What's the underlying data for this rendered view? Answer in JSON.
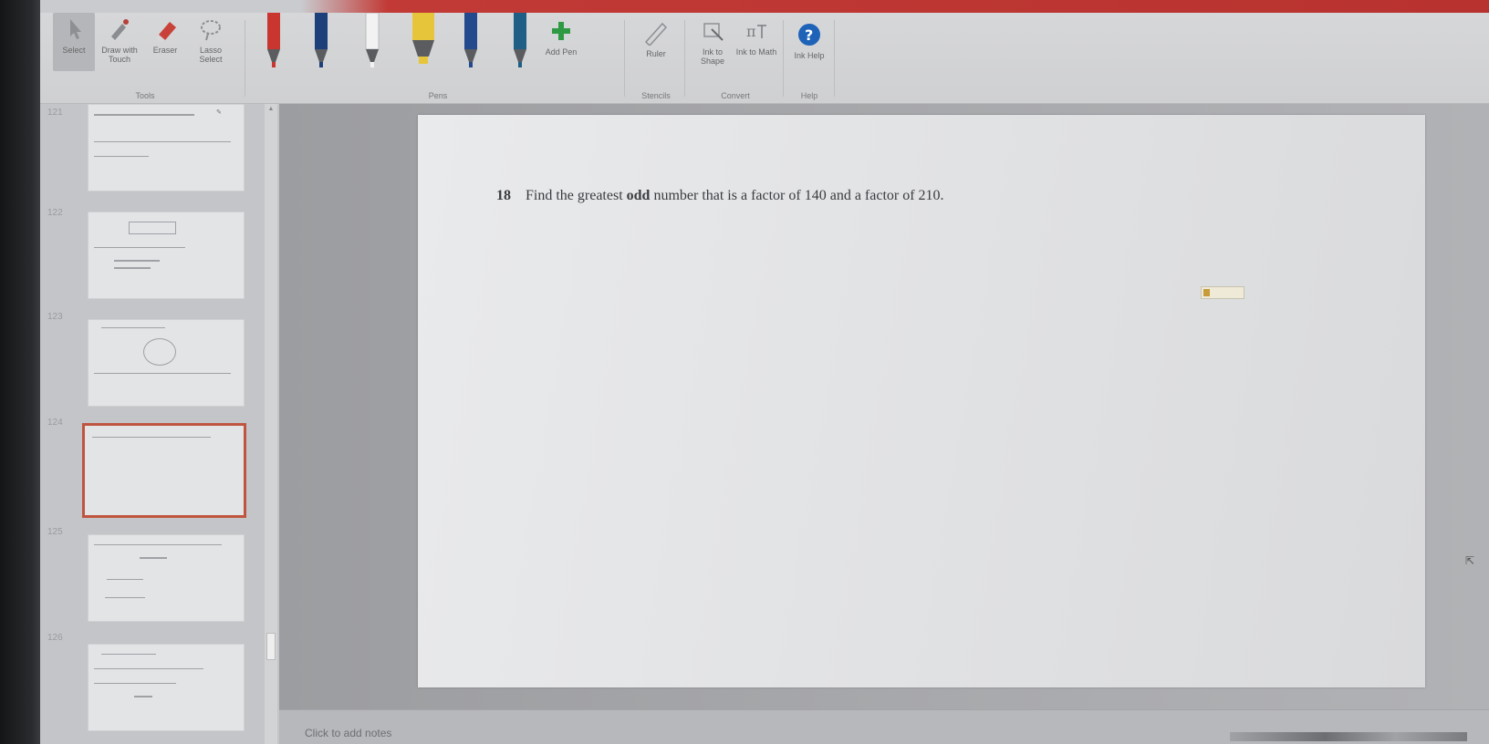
{
  "ribbon": {
    "tools_group": {
      "label": "Tools",
      "items": [
        {
          "label": "Select"
        },
        {
          "label": "Draw with Touch"
        },
        {
          "label": "Eraser"
        },
        {
          "label": "Lasso Select"
        }
      ]
    },
    "pens_group": {
      "label": "Pens",
      "pen_colors": [
        "#c9352f",
        "#1d3f7a",
        "#f2f2f2",
        "#e7c53b",
        "#234a8c",
        "#1f5f86"
      ],
      "add_pen_label": "Add Pen"
    },
    "stencils_group": {
      "label": "Stencils",
      "ruler_label": "Ruler"
    },
    "convert_group": {
      "label": "Convert",
      "ink_to_shape_label": "Ink to Shape",
      "ink_to_math_label": "Ink to Math"
    },
    "help_group": {
      "label": "Help",
      "ink_help_label": "Ink Help"
    }
  },
  "thumbnails": [
    {
      "number": "121",
      "selected": false
    },
    {
      "number": "122",
      "selected": false
    },
    {
      "number": "123",
      "selected": false
    },
    {
      "number": "124",
      "selected": true
    },
    {
      "number": "125",
      "selected": false
    },
    {
      "number": "126",
      "selected": false
    }
  ],
  "slide": {
    "question_number": "18",
    "question_before": "Find the greatest ",
    "question_bold": "odd",
    "question_after": " number that is a factor of 140 and a factor of 210."
  },
  "notes": {
    "placeholder": "Click to add notes"
  },
  "colors": {
    "title_bar": "#c23a36",
    "selected_thumb_border": "#c0553f",
    "help_icon": "#1e63b8",
    "add_pen_icon": "#2e9a43"
  }
}
